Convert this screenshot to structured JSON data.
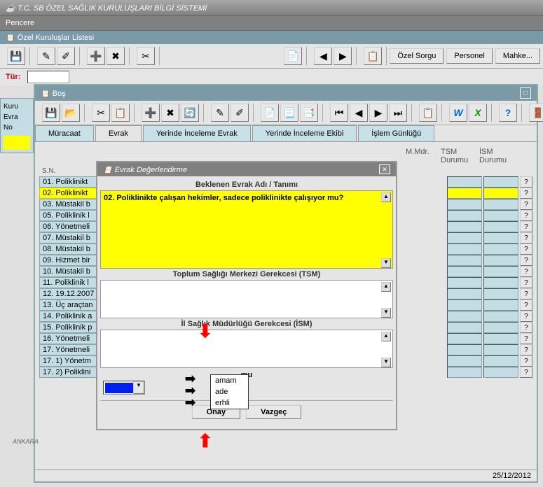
{
  "app_title": "T.C. SB ÖZEL SAĞLIK KURULUŞLARI BİLGİ SİSTEMİ",
  "menu": {
    "pencere": "Pencere"
  },
  "subtitle": "Özel Kuruluşlar Listesi",
  "toolbar_buttons": {
    "ozel_sorgu": "Özel Sorgu",
    "personel": "Personel",
    "mahke": "Mahke..."
  },
  "tur_label": "Tür:",
  "left_panel": {
    "kuru": "Kuru",
    "evra": "Evra",
    "no": "No"
  },
  "inner_window": {
    "title": "Boş"
  },
  "tabs": {
    "muracaat": "Müracaat",
    "evrak": "Evrak",
    "yerinde_inceleme_evrak": "Yerinde İnceleme Evrak",
    "yerinde_inceleme_ekibi": "Yerinde İnceleme Ekibi",
    "islem_gunlugu": "İşlem Günlüğü"
  },
  "columns": {
    "sn": "S.N.",
    "mmdr": "M.Mdr.",
    "tsm_durumu": "TSM Durumu",
    "ism_durumu": "İSM Durumu"
  },
  "rows": [
    {
      "text": "01. Poliklinikt",
      "highlight": false
    },
    {
      "text": "02. Poliklinikt",
      "highlight": true
    },
    {
      "text": "03. Müstakil b",
      "highlight": false
    },
    {
      "text": "05. Poliklinik l",
      "highlight": false
    },
    {
      "text": "06. Yönetmeli",
      "highlight": false
    },
    {
      "text": "07. Müstakil b",
      "highlight": false
    },
    {
      "text": "08. Müstakil b",
      "highlight": false
    },
    {
      "text": "09. Hizmet bir",
      "highlight": false
    },
    {
      "text": "10. Müstakil b",
      "highlight": false
    },
    {
      "text": "11. Poliklinik l",
      "highlight": false
    },
    {
      "text": "12. 19.12.2007",
      "highlight": false
    },
    {
      "text": "13. Üç araçtan",
      "highlight": false
    },
    {
      "text": "14. Poliklinik a",
      "highlight": false
    },
    {
      "text": "15. Poliklinik p",
      "highlight": false
    },
    {
      "text": "16. Yönetmeli",
      "highlight": false
    },
    {
      "text": "17. Yönetmeli",
      "highlight": false
    },
    {
      "text": "17. 1) Yönetm",
      "highlight": false
    },
    {
      "text": "17. 2) Poliklini",
      "highlight": false
    }
  ],
  "dialog": {
    "title": "Evrak Değerlendirme",
    "section1_label": "Beklenen Evrak Adı / Tanımı",
    "question_text": "02. Poliklinikte çalışan hekimler, sadece poliklinikte çalışıyor mu?",
    "section2_label": "Toplum Sağlığı Merkezi Gerekcesi (TSM)",
    "section3_label": "İl Sağlık Müdürlüğü Gerekcesi (İSM)",
    "durum_label": "mu",
    "dropdown_options": [
      "amam",
      "ade",
      "erhli"
    ],
    "onay": "Onay",
    "vazgec": "Vazgeç"
  },
  "statusbar": {
    "date": "25/12/2012"
  },
  "ankara": "ANKARA"
}
